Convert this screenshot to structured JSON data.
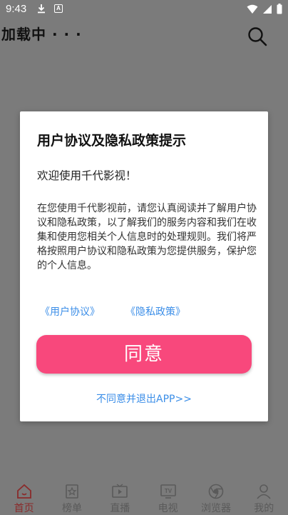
{
  "status_bar": {
    "time": "9:43",
    "notification_badge": "A"
  },
  "header": {
    "title": "加载中 · · ·"
  },
  "dialog": {
    "title": "用户协议及隐私政策提示",
    "welcome": "欢迎使用千代影视！",
    "body": "在您使用千代影视前，请您认真阅读并了解用户协议和隐私政策，以了解我们的服务内容和我们在收集和使用您相关个人信息时的处理规则。我们将严格按照用户协议和隐私政策为您提供服务，保护您的个人信息。",
    "user_agreement_link": "《用户协议》",
    "privacy_policy_link": "《隐私政策》",
    "agree_button": "同意",
    "disagree_link": "不同意并退出APP>>"
  },
  "colors": {
    "accent": "#f8487c",
    "link": "#3b8ee8",
    "overlay": "#7b7b7b"
  },
  "tabbar": {
    "items": [
      {
        "label": "首页",
        "icon": "home-icon",
        "active": true
      },
      {
        "label": "榜单",
        "icon": "ranking-icon",
        "active": false
      },
      {
        "label": "直播",
        "icon": "live-tv-icon",
        "active": false
      },
      {
        "label": "电视",
        "icon": "tv-icon",
        "active": false
      },
      {
        "label": "浏览器",
        "icon": "browser-icon",
        "active": false
      },
      {
        "label": "我的",
        "icon": "profile-icon",
        "active": false
      }
    ]
  }
}
